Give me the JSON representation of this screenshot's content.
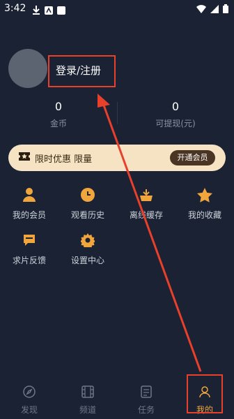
{
  "status_bar": {
    "time": "3:42"
  },
  "profile": {
    "login_label": "登录/注册"
  },
  "stats": [
    {
      "value": "0",
      "label": "金币"
    },
    {
      "value": "0",
      "label": "可提现(元)"
    }
  ],
  "vip": {
    "text": "限时优惠 限量",
    "button": "开通会员"
  },
  "menu": [
    {
      "label": "我的会员",
      "icon": "person-icon"
    },
    {
      "label": "观看历史",
      "icon": "clock-icon"
    },
    {
      "label": "离线缓存",
      "icon": "download-icon"
    },
    {
      "label": "我的收藏",
      "icon": "star-icon"
    },
    {
      "label": "求片反馈",
      "icon": "chat-icon"
    },
    {
      "label": "设置中心",
      "icon": "gear-icon"
    }
  ],
  "tabs": [
    {
      "label": "发现",
      "icon": "compass-icon"
    },
    {
      "label": "频道",
      "icon": "film-icon"
    },
    {
      "label": "任务",
      "icon": "task-icon"
    },
    {
      "label": "我的",
      "icon": "profile-icon"
    }
  ],
  "colors": {
    "accent": "#f0a63c",
    "annotation": "#e8402b",
    "background": "#1a2233"
  }
}
